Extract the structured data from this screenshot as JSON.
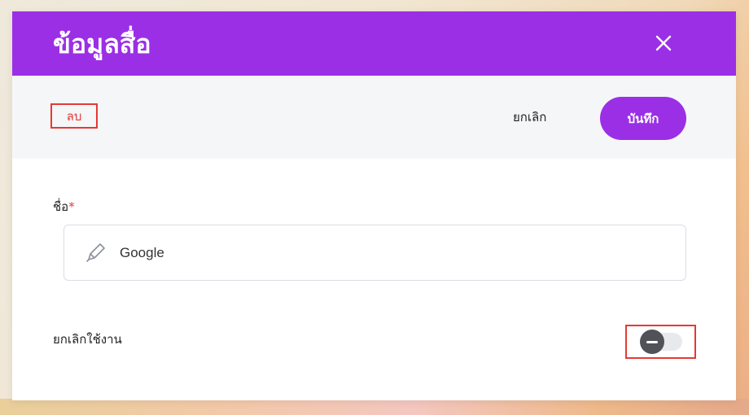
{
  "modal": {
    "title": "ข้อมูลสื่อ",
    "close_icon": "close-icon",
    "accent_color": "#9b2fe6"
  },
  "actions": {
    "delete_label": "ลบ",
    "cancel_label": "ยกเลิก",
    "save_label": "บันทึก",
    "highlight_color": "#e53935"
  },
  "form": {
    "name_label": "ชื่อ",
    "required_marker": "*",
    "name_value": "Google",
    "name_icon": "pencil-icon",
    "disable_label": "ยกเลิกใช้งาน",
    "disable_toggle_on": false
  }
}
